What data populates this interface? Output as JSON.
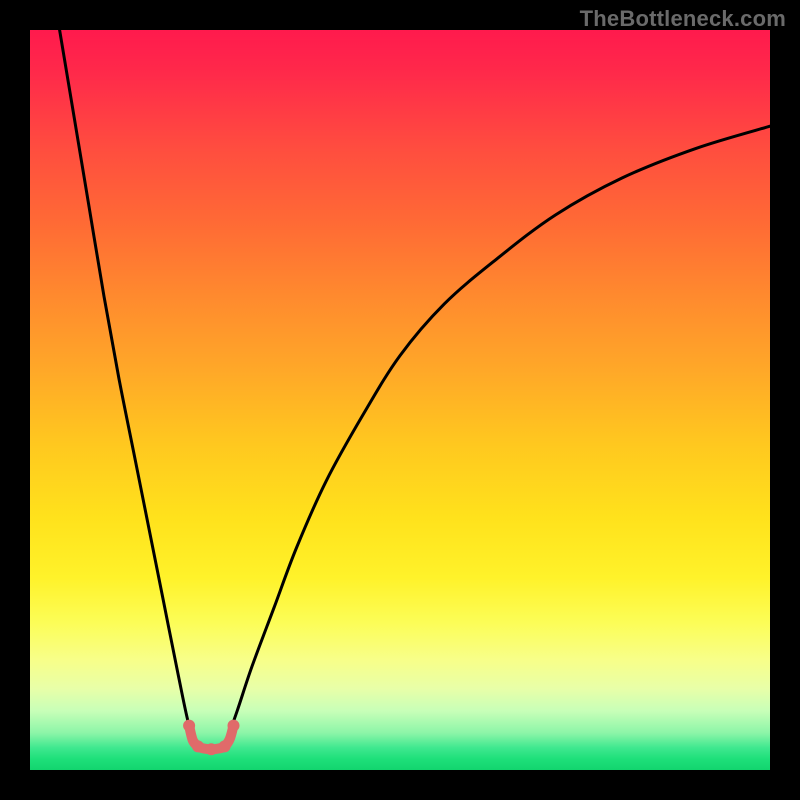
{
  "watermark": "TheBottleneck.com",
  "chart_data": {
    "type": "line",
    "title": "",
    "xlabel": "",
    "ylabel": "",
    "xlim": [
      0,
      100
    ],
    "ylim": [
      0,
      100
    ],
    "grid": false,
    "legend": false,
    "series": [
      {
        "name": "left-curve",
        "stroke": "#000000",
        "x": [
          4,
          6,
          8,
          10,
          12,
          14,
          16,
          18,
          20,
          21.5,
          22.7
        ],
        "values": [
          100,
          88,
          76,
          64,
          53,
          43,
          33,
          23,
          13,
          6,
          3.2
        ]
      },
      {
        "name": "right-curve",
        "stroke": "#000000",
        "x": [
          26.3,
          28,
          30,
          33,
          36,
          40,
          45,
          50,
          56,
          63,
          71,
          80,
          90,
          100
        ],
        "values": [
          3.2,
          8,
          14,
          22,
          30,
          39,
          48,
          56,
          63,
          69,
          75,
          80,
          84,
          87
        ]
      },
      {
        "name": "cup-highlight",
        "stroke": "#e06a6a",
        "x": [
          21.5,
          22.0,
          22.7,
          23.5,
          24.5,
          25.5,
          26.3,
          27.0,
          27.5
        ],
        "values": [
          6.0,
          4.0,
          3.2,
          2.9,
          2.8,
          2.9,
          3.2,
          4.2,
          6.0
        ]
      }
    ],
    "markers": [
      {
        "series": "cup-highlight",
        "x": 21.5,
        "y": 6.0,
        "r": 6,
        "fill": "#e06a6a"
      },
      {
        "series": "cup-highlight",
        "x": 22.7,
        "y": 3.2,
        "r": 6,
        "fill": "#e06a6a"
      },
      {
        "series": "cup-highlight",
        "x": 24.5,
        "y": 2.8,
        "r": 6,
        "fill": "#e06a6a"
      },
      {
        "series": "cup-highlight",
        "x": 26.3,
        "y": 3.2,
        "r": 6,
        "fill": "#e06a6a"
      },
      {
        "series": "cup-highlight",
        "x": 27.5,
        "y": 6.0,
        "r": 6,
        "fill": "#e06a6a"
      }
    ]
  }
}
